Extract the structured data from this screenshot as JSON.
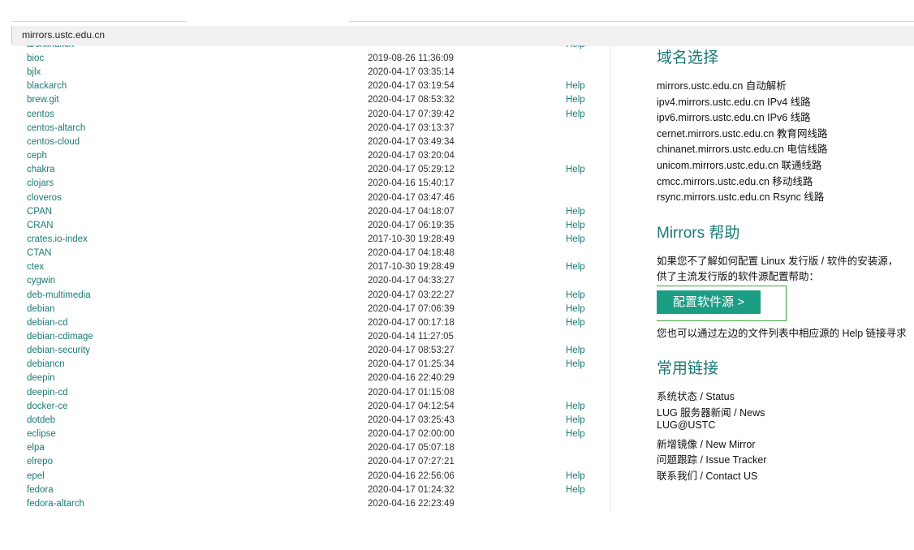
{
  "address": {
    "url": "mirrors.ustc.edu.cn"
  },
  "listing": {
    "partial_top": {
      "name": "archlinuxcn",
      "help": "Help"
    },
    "rows": [
      {
        "name": "bioc",
        "date": "2019-08-26 11:36:09",
        "help": ""
      },
      {
        "name": "bjlx",
        "date": "2020-04-17 03:35:14",
        "help": ""
      },
      {
        "name": "blackarch",
        "date": "2020-04-17 03:19:54",
        "help": "Help"
      },
      {
        "name": "brew.git",
        "date": "2020-04-17 08:53:32",
        "help": "Help"
      },
      {
        "name": "centos",
        "date": "2020-04-17 07:39:42",
        "help": "Help"
      },
      {
        "name": "centos-altarch",
        "date": "2020-04-17 03:13:37",
        "help": ""
      },
      {
        "name": "centos-cloud",
        "date": "2020-04-17 03:49:34",
        "help": ""
      },
      {
        "name": "ceph",
        "date": "2020-04-17 03:20:04",
        "help": ""
      },
      {
        "name": "chakra",
        "date": "2020-04-17 05:29:12",
        "help": "Help"
      },
      {
        "name": "clojars",
        "date": "2020-04-16 15:40:17",
        "help": ""
      },
      {
        "name": "cloveros",
        "date": "2020-04-17 03:47:46",
        "help": ""
      },
      {
        "name": "CPAN",
        "date": "2020-04-17 04:18:07",
        "help": "Help"
      },
      {
        "name": "CRAN",
        "date": "2020-04-17 06:19:35",
        "help": "Help"
      },
      {
        "name": "crates.io-index",
        "date": "2017-10-30 19:28:49",
        "help": "Help"
      },
      {
        "name": "CTAN",
        "date": "2020-04-17 04:18:48",
        "help": ""
      },
      {
        "name": "ctex",
        "date": "2017-10-30 19:28:49",
        "help": "Help"
      },
      {
        "name": "cygwin",
        "date": "2020-04-17 04:33:27",
        "help": ""
      },
      {
        "name": "deb-multimedia",
        "date": "2020-04-17 03:22:27",
        "help": "Help"
      },
      {
        "name": "debian",
        "date": "2020-04-17 07:06:39",
        "help": "Help"
      },
      {
        "name": "debian-cd",
        "date": "2020-04-17 00:17:18",
        "help": "Help"
      },
      {
        "name": "debian-cdimage",
        "date": "2020-04-14 11:27:05",
        "help": ""
      },
      {
        "name": "debian-security",
        "date": "2020-04-17 08:53:27",
        "help": "Help"
      },
      {
        "name": "debiancn",
        "date": "2020-04-17 01:25:34",
        "help": "Help"
      },
      {
        "name": "deepin",
        "date": "2020-04-16 22:40:29",
        "help": ""
      },
      {
        "name": "deepin-cd",
        "date": "2020-04-17 01:15:08",
        "help": ""
      },
      {
        "name": "docker-ce",
        "date": "2020-04-17 04:12:54",
        "help": "Help"
      },
      {
        "name": "dotdeb",
        "date": "2020-04-17 03:25:43",
        "help": "Help"
      },
      {
        "name": "eclipse",
        "date": "2020-04-17 02:00:00",
        "help": "Help"
      },
      {
        "name": "elpa",
        "date": "2020-04-17 05:07:18",
        "help": ""
      },
      {
        "name": "elrepo",
        "date": "2020-04-17 07:27:21",
        "help": ""
      },
      {
        "name": "epel",
        "date": "2020-04-16 22:56:06",
        "help": "Help"
      },
      {
        "name": "fedora",
        "date": "2020-04-17 01:24:32",
        "help": "Help"
      },
      {
        "name": "fedora-altarch",
        "date": "2020-04-16 22:23:49",
        "help": ""
      }
    ]
  },
  "sidebar": {
    "domain_heading": "域名选择",
    "domains": [
      "mirrors.ustc.edu.cn 自动解析",
      "ipv4.mirrors.ustc.edu.cn IPv4 线路",
      "ipv6.mirrors.ustc.edu.cn IPv6 线路",
      "cernet.mirrors.ustc.edu.cn 教育网线路",
      "chinanet.mirrors.ustc.edu.cn 电信线路",
      "unicom.mirrors.ustc.edu.cn 联通线路",
      "cmcc.mirrors.ustc.edu.cn 移动线路",
      "rsync.mirrors.ustc.edu.cn Rsync 线路"
    ],
    "help_heading": "Mirrors 帮助",
    "help_text_1": "如果您不了解如何配置 Linux 发行版 / 软件的安装源，",
    "help_text_2": "供了主流发行版的软件源配置帮助：",
    "config_button": "配置软件源 >",
    "help_text_3": "您也可以通过左边的文件列表中相应源的 Help 链接寻求",
    "links_heading": "常用链接",
    "links": [
      "系统状态 / Status",
      "LUG 服务器新闻 / News",
      "LUG@USTC",
      "新增镜像 / New Mirror",
      "问题跟踪 / Issue Tracker",
      "联系我们 / Contact US"
    ]
  },
  "colors": {
    "link": "#1b7a75",
    "button": "#1c9e84",
    "button_frame": "#3fa43f"
  }
}
